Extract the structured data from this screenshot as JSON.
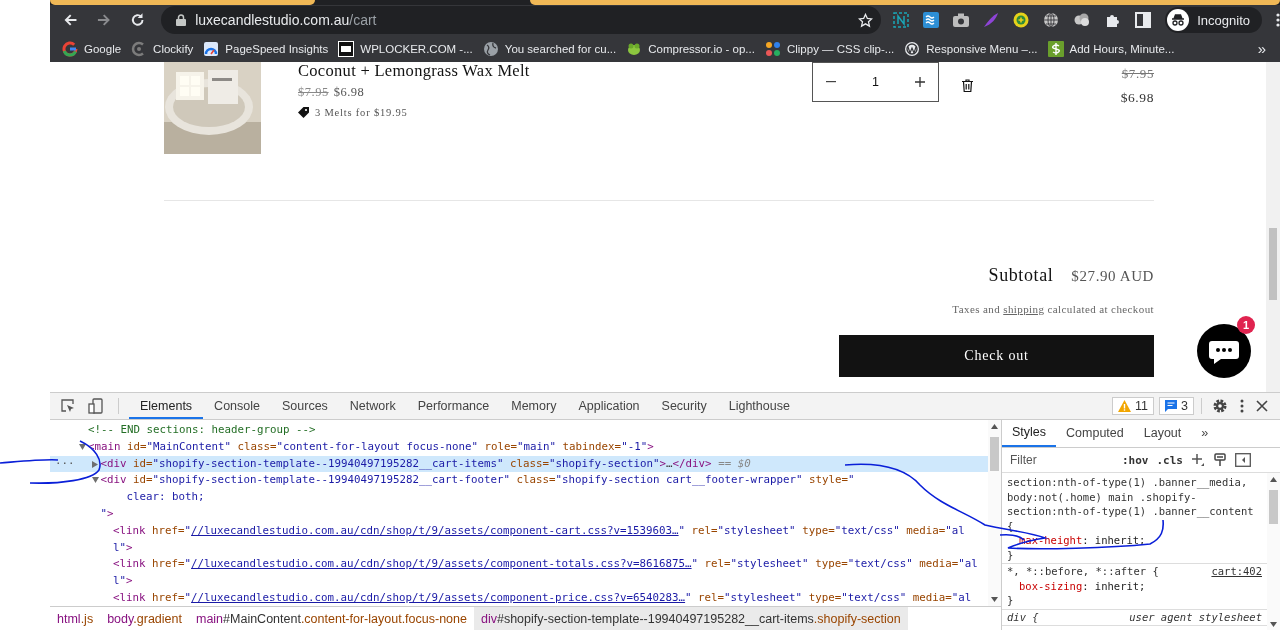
{
  "browser": {
    "url_host": "luxecandlestudio.com.au",
    "url_path": "/cart",
    "profile": "Incognito",
    "bookmarks": [
      {
        "label": "Google",
        "kind": "g"
      },
      {
        "label": "Clockify",
        "kind": "arc"
      },
      {
        "label": "PageSpeed Insights",
        "kind": "gauge"
      },
      {
        "label": "WPLOCKER.COM -...",
        "kind": "square"
      },
      {
        "label": "You searched for cu...",
        "kind": "globe"
      },
      {
        "label": "Compressor.io - op...",
        "kind": "creature"
      },
      {
        "label": "Clippy — CSS clip-...",
        "kind": "dots"
      },
      {
        "label": "Responsive Menu –...",
        "kind": "ring"
      },
      {
        "label": "Add Hours, Minute...",
        "kind": "money"
      }
    ],
    "more_bookmarks": "»"
  },
  "cart_item": {
    "title": "Coconut + Lemongrass Wax Melt",
    "original_price": "$7.95",
    "price": "$6.98",
    "discount": "3 Melts for $19.95",
    "quantity": "1",
    "line_original": "$7.95",
    "line_price": "$6.98"
  },
  "cart_footer": {
    "subtotal_label": "Subtotal",
    "subtotal": "$27.90 AUD",
    "tax_before": "Taxes and",
    "tax_link": "shipping",
    "tax_after": "calculated at checkout",
    "checkout": "Check out"
  },
  "chat": {
    "badge": "1"
  },
  "devtools": {
    "tabs": [
      {
        "label": "Elements",
        "selected": true
      },
      {
        "label": "Console",
        "selected": false
      },
      {
        "label": "Sources",
        "selected": false
      },
      {
        "label": "Network",
        "selected": false
      },
      {
        "label": "Performance",
        "selected": false
      },
      {
        "label": "Memory",
        "selected": false
      },
      {
        "label": "Application",
        "selected": false
      },
      {
        "label": "Security",
        "selected": false
      },
      {
        "label": "Lighthouse",
        "selected": false
      }
    ],
    "warnings": "11",
    "messages": "3",
    "row_menu": "...",
    "dom": [
      {
        "selected": false,
        "lines": [
          [
            {
              "kind": "comment",
              "text": "<!-- END sections: header-group -->"
            }
          ]
        ]
      },
      {
        "selected": false,
        "expanded": true,
        "lines": [
          [
            {
              "kind": "tag",
              "text": "<main"
            },
            {
              "kind": "attr",
              "text": " id="
            },
            {
              "kind": "value",
              "text": "\"MainContent\""
            },
            {
              "kind": "attr",
              "text": " class="
            },
            {
              "kind": "value",
              "text": "\"content-for-layout focus-none\""
            },
            {
              "kind": "attr",
              "text": " role="
            },
            {
              "kind": "value",
              "text": "\"main\""
            },
            {
              "kind": "attr",
              "text": " tabindex="
            },
            {
              "kind": "value",
              "text": "\"-1\""
            },
            {
              "kind": "tag",
              "text": ">"
            }
          ]
        ],
        "children": [
          {
            "selected": true,
            "expanded": false,
            "lines": [
              [
                {
                  "kind": "tag",
                  "text": "<div"
                },
                {
                  "kind": "attr",
                  "text": " id="
                },
                {
                  "kind": "value",
                  "text": "\"shopify-section-template--19940497195282__cart-items\""
                },
                {
                  "kind": "attr",
                  "text": " class="
                },
                {
                  "kind": "value",
                  "text": "\"shopify-section\""
                },
                {
                  "kind": "tag",
                  "text": ">"
                },
                {
                  "kind": "plain",
                  "text": "…"
                },
                {
                  "kind": "tag",
                  "text": "</div>"
                },
                {
                  "kind": "dim",
                  "text": " == $0"
                }
              ]
            ]
          },
          {
            "selected": false,
            "expanded": true,
            "lines": [
              [
                {
                  "kind": "tag",
                  "text": "<div"
                },
                {
                  "kind": "attr",
                  "text": " id="
                },
                {
                  "kind": "value",
                  "text": "\"shopify-section-template--19940497195282__cart-footer\""
                },
                {
                  "kind": "attr",
                  "text": " class="
                },
                {
                  "kind": "value",
                  "text": "\"shopify-section cart__footer-wrapper\""
                },
                {
                  "kind": "attr",
                  "text": " style="
                },
                {
                  "kind": "value",
                  "text": "\""
                }
              ],
              [
                {
                  "kind": "value",
                  "text": "    clear: both;"
                }
              ],
              [
                {
                  "kind": "value",
                  "text": "\""
                },
                {
                  "kind": "tag",
                  "text": ">"
                }
              ]
            ],
            "children": [
              {
                "selected": false,
                "lines": [
                  [
                    {
                      "kind": "tag",
                      "text": "<link"
                    },
                    {
                      "kind": "attr",
                      "text": " href="
                    },
                    {
                      "kind": "value",
                      "text": "\""
                    },
                    {
                      "kind": "link",
                      "text": "//luxecandlestudio.com.au/cdn/shop/t/9/assets/component-cart.css?v=1539603…"
                    },
                    {
                      "kind": "value",
                      "text": "\""
                    },
                    {
                      "kind": "attr",
                      "text": " rel="
                    },
                    {
                      "kind": "value",
                      "text": "\"stylesheet\""
                    },
                    {
                      "kind": "attr",
                      "text": " type="
                    },
                    {
                      "kind": "value",
                      "text": "\"text/css\""
                    },
                    {
                      "kind": "attr",
                      "text": " media="
                    },
                    {
                      "kind": "value",
                      "text": "\"al"
                    }
                  ],
                  [
                    {
                      "kind": "value",
                      "text": "l\""
                    },
                    {
                      "kind": "tag",
                      "text": ">"
                    }
                  ]
                ]
              },
              {
                "selected": false,
                "lines": [
                  [
                    {
                      "kind": "tag",
                      "text": "<link"
                    },
                    {
                      "kind": "attr",
                      "text": " href="
                    },
                    {
                      "kind": "value",
                      "text": "\""
                    },
                    {
                      "kind": "link",
                      "text": "//luxecandlestudio.com.au/cdn/shop/t/9/assets/component-totals.css?v=8616875…"
                    },
                    {
                      "kind": "value",
                      "text": "\""
                    },
                    {
                      "kind": "attr",
                      "text": " rel="
                    },
                    {
                      "kind": "value",
                      "text": "\"stylesheet\""
                    },
                    {
                      "kind": "attr",
                      "text": " type="
                    },
                    {
                      "kind": "value",
                      "text": "\"text/css\""
                    },
                    {
                      "kind": "attr",
                      "text": " media="
                    },
                    {
                      "kind": "value",
                      "text": "\"al"
                    }
                  ],
                  [
                    {
                      "kind": "value",
                      "text": "l\""
                    },
                    {
                      "kind": "tag",
                      "text": ">"
                    }
                  ]
                ]
              },
              {
                "selected": false,
                "lines": [
                  [
                    {
                      "kind": "tag",
                      "text": "<link"
                    },
                    {
                      "kind": "attr",
                      "text": " href="
                    },
                    {
                      "kind": "value",
                      "text": "\""
                    },
                    {
                      "kind": "link",
                      "text": "//luxecandlestudio.com.au/cdn/shop/t/9/assets/component-price.css?v=6540283…"
                    },
                    {
                      "kind": "value",
                      "text": "\""
                    },
                    {
                      "kind": "attr",
                      "text": " rel="
                    },
                    {
                      "kind": "value",
                      "text": "\"stylesheet\""
                    },
                    {
                      "kind": "attr",
                      "text": " type="
                    },
                    {
                      "kind": "value",
                      "text": "\"text/css\""
                    },
                    {
                      "kind": "attr",
                      "text": " media="
                    },
                    {
                      "kind": "value",
                      "text": "\"al"
                    }
                  ]
                ]
              }
            ]
          }
        ]
      }
    ],
    "breadcrumbs": [
      {
        "tag": "html",
        "classes": ".js",
        "selected": false
      },
      {
        "tag": "body",
        "classes": ".gradient",
        "selected": false
      },
      {
        "tag": "main",
        "id": "#MainContent",
        "classes": ".content-for-layout.focus-none",
        "selected": false
      },
      {
        "tag": "div",
        "id": "#shopify-section-template--19940497195282__cart-items",
        "classes": ".shopify-section",
        "selected": true
      }
    ],
    "side_tabs": [
      {
        "label": "Styles",
        "selected": true
      },
      {
        "label": "Computed",
        "selected": false
      },
      {
        "label": "Layout",
        "selected": false
      }
    ],
    "side_more": "»",
    "filter": {
      "placeholder": "Filter"
    },
    "hov": ":hov",
    "cls": ".cls",
    "rules": [
      {
        "selector_lines": [
          "section:nth-of-type(1) .banner__media,",
          "body:not(.home) main .shopify-",
          "section:nth-of-type(1) .banner__content",
          "{"
        ],
        "declarations": [
          {
            "property": "max-height",
            "rest": ": inherit;"
          }
        ],
        "close": "}"
      },
      {
        "selector_lines": [
          "*, *::before, *::after {"
        ],
        "source": "cart:402",
        "declarations": [
          {
            "property": "box-sizing",
            "rest": ": inherit;"
          }
        ],
        "close": "}"
      },
      {
        "selector_lines": [
          "div {"
        ],
        "source": "user agent stylesheet",
        "italic": true
      }
    ]
  }
}
